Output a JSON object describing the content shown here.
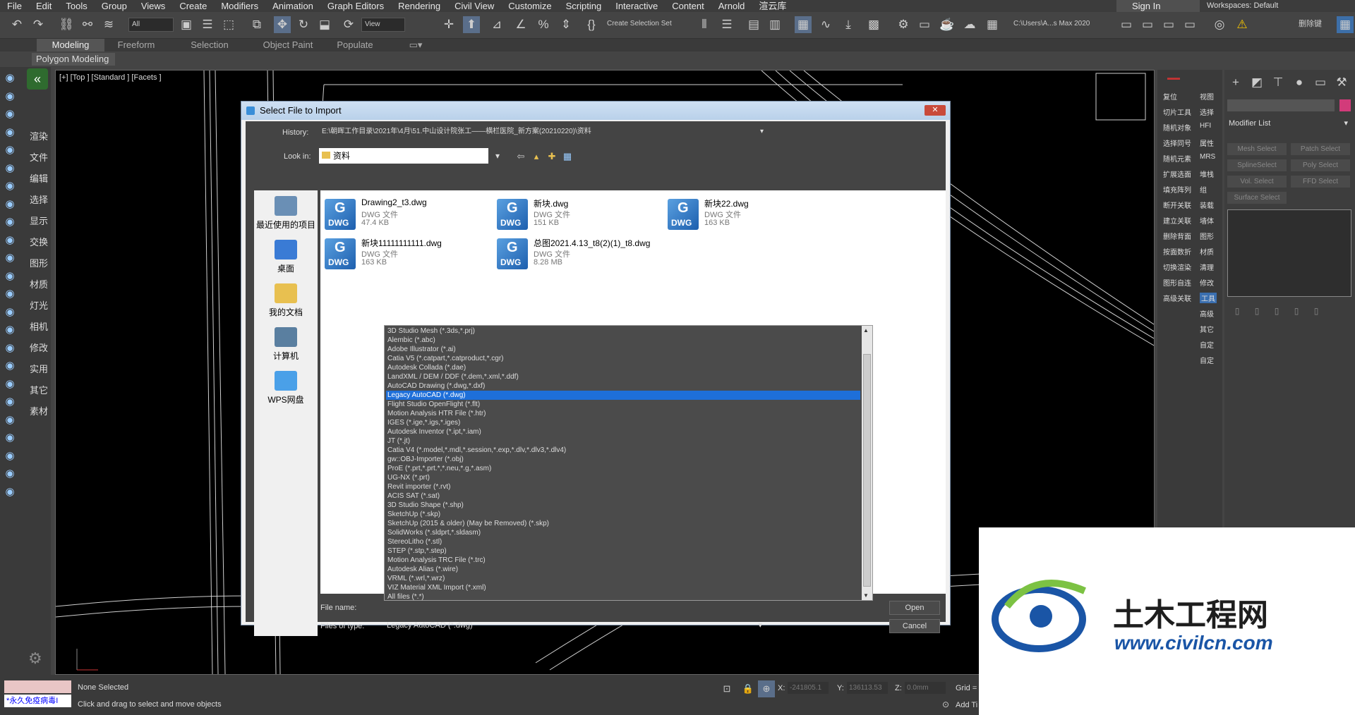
{
  "menu": [
    "File",
    "Edit",
    "Tools",
    "Group",
    "Views",
    "Create",
    "Modifiers",
    "Animation",
    "Graph Editors",
    "Rendering",
    "Civil View",
    "Customize",
    "Scripting",
    "Interactive",
    "Content",
    "Arnold",
    "渲云库"
  ],
  "signin": "Sign In",
  "workspaces": {
    "label": "Workspaces:",
    "value": "Default"
  },
  "toolbar": {
    "filter": "All",
    "view": "View",
    "selset": "Create Selection Set",
    "path": "C:\\Users\\A...s Max 2020",
    "user": "删除键"
  },
  "ribbon_tabs": [
    "Modeling",
    "Freeform",
    "Selection",
    "Object Paint",
    "Populate"
  ],
  "ribbon_panel": "Polygon Modeling",
  "left_labels": [
    "渲染",
    "文件",
    "编辑",
    "选择",
    "显示",
    "交换",
    "图形",
    "材质",
    "灯光",
    "相机",
    "修改",
    "实用",
    "其它",
    "素材"
  ],
  "viewport_label": "[+] [Top ] [Standard ] [Facets ]",
  "right_labels_a": [
    "复位",
    "切片工具",
    "随机对象",
    "选择同号",
    "随机元素",
    "扩展选面",
    "填充阵列",
    "断开关联",
    "建立关联",
    "删除背面",
    "按面数折",
    "切换渲染",
    "图形自连",
    "高级关联"
  ],
  "right_labels_b": [
    "视图",
    "选择",
    "HFI",
    "属性",
    "MRS",
    "堆栈",
    "组",
    "装载",
    "墙体",
    "图形",
    "材质",
    "清理",
    "修改",
    "工具",
    "高级",
    "其它",
    "自定",
    "自定"
  ],
  "cmd_panel": {
    "modifier_list": "Modifier List",
    "buttons": [
      "Mesh Select",
      "Patch Select",
      "SplineSelect",
      "Poly Select",
      "Vol. Select",
      "FFD Select",
      "Surface Select"
    ]
  },
  "status": {
    "selected": "None Selected",
    "hint": "Click and drag to select and move objects",
    "x_label": "X:",
    "x": "-241805.1",
    "y_label": "Y:",
    "y": "136113.53",
    "z_label": "Z:",
    "z": "0.0mm",
    "grid": "Grid =",
    "addtime": "Add Ti",
    "script": "*永久免疫病毒I"
  },
  "dialog": {
    "title": "Select File to Import",
    "history_label": "History:",
    "history": "E:\\朝晖工作目录\\2021年\\4月\\51.中山设计院张工——横栏医院_新方案(20210220)\\资料",
    "lookin_label": "Look in:",
    "lookin": "资料",
    "places": [
      "最近使用的项目",
      "桌面",
      "我的文档",
      "计算机",
      "WPS网盘"
    ],
    "files": [
      {
        "name": "Drawing2_t3.dwg",
        "type": "DWG 文件",
        "size": "47.4 KB"
      },
      {
        "name": "新块.dwg",
        "type": "DWG 文件",
        "size": "151 KB"
      },
      {
        "name": "新块22.dwg",
        "type": "DWG 文件",
        "size": "163 KB"
      },
      {
        "name": "新块11111111111.dwg",
        "type": "DWG 文件",
        "size": "163 KB"
      },
      {
        "name": "总图2021.4.13_t8(2)(1)_t8.dwg",
        "type": "DWG 文件",
        "size": "8.28 MB"
      }
    ],
    "filename_label": "File name:",
    "filetype_label": "Files of type:",
    "filetype": "Legacy AutoCAD (*.dwg)",
    "open": "Open",
    "cancel": "Cancel",
    "file_types": [
      "3D Studio Mesh (*.3ds,*.prj)",
      "Alembic (*.abc)",
      "Adobe Illustrator (*.ai)",
      "Catia V5 (*.catpart,*.catproduct,*.cgr)",
      "Autodesk Collada (*.dae)",
      "LandXML / DEM / DDF (*.dem,*.xml,*.ddf)",
      "AutoCAD Drawing (*.dwg,*.dxf)",
      "Legacy AutoCAD (*.dwg)",
      "Flight Studio OpenFlight (*.flt)",
      "Motion Analysis HTR File (*.htr)",
      "IGES (*.ige,*.igs,*.iges)",
      "Autodesk Inventor (*.ipt,*.iam)",
      "JT (*.jt)",
      "Catia V4 (*.model,*.mdl,*.session,*.exp,*.dlv,*.dlv3,*.dlv4)",
      "gw::OBJ-Importer (*.obj)",
      "ProE (*.prt,*.prt.*,*.neu,*.g,*.asm)",
      "UG-NX (*.prt)",
      "Revit importer (*.rvt)",
      "ACIS SAT (*.sat)",
      "3D Studio Shape (*.shp)",
      "SketchUp (*.skp)",
      "SketchUp (2015 & older) (May be Removed) (*.skp)",
      "SolidWorks (*.sldprt,*.sldasm)",
      "StereoLitho (*.stl)",
      "STEP (*.stp,*.step)",
      "Motion Analysis TRC File (*.trc)",
      "Autodesk Alias (*.wire)",
      "VRML (*.wrl,*.wrz)",
      "VIZ Material XML Import (*.xml)",
      "All files (*.*)"
    ],
    "selected_index": 7
  },
  "watermark": {
    "cn": "土木工程网",
    "url": "www.civilcn.com"
  }
}
